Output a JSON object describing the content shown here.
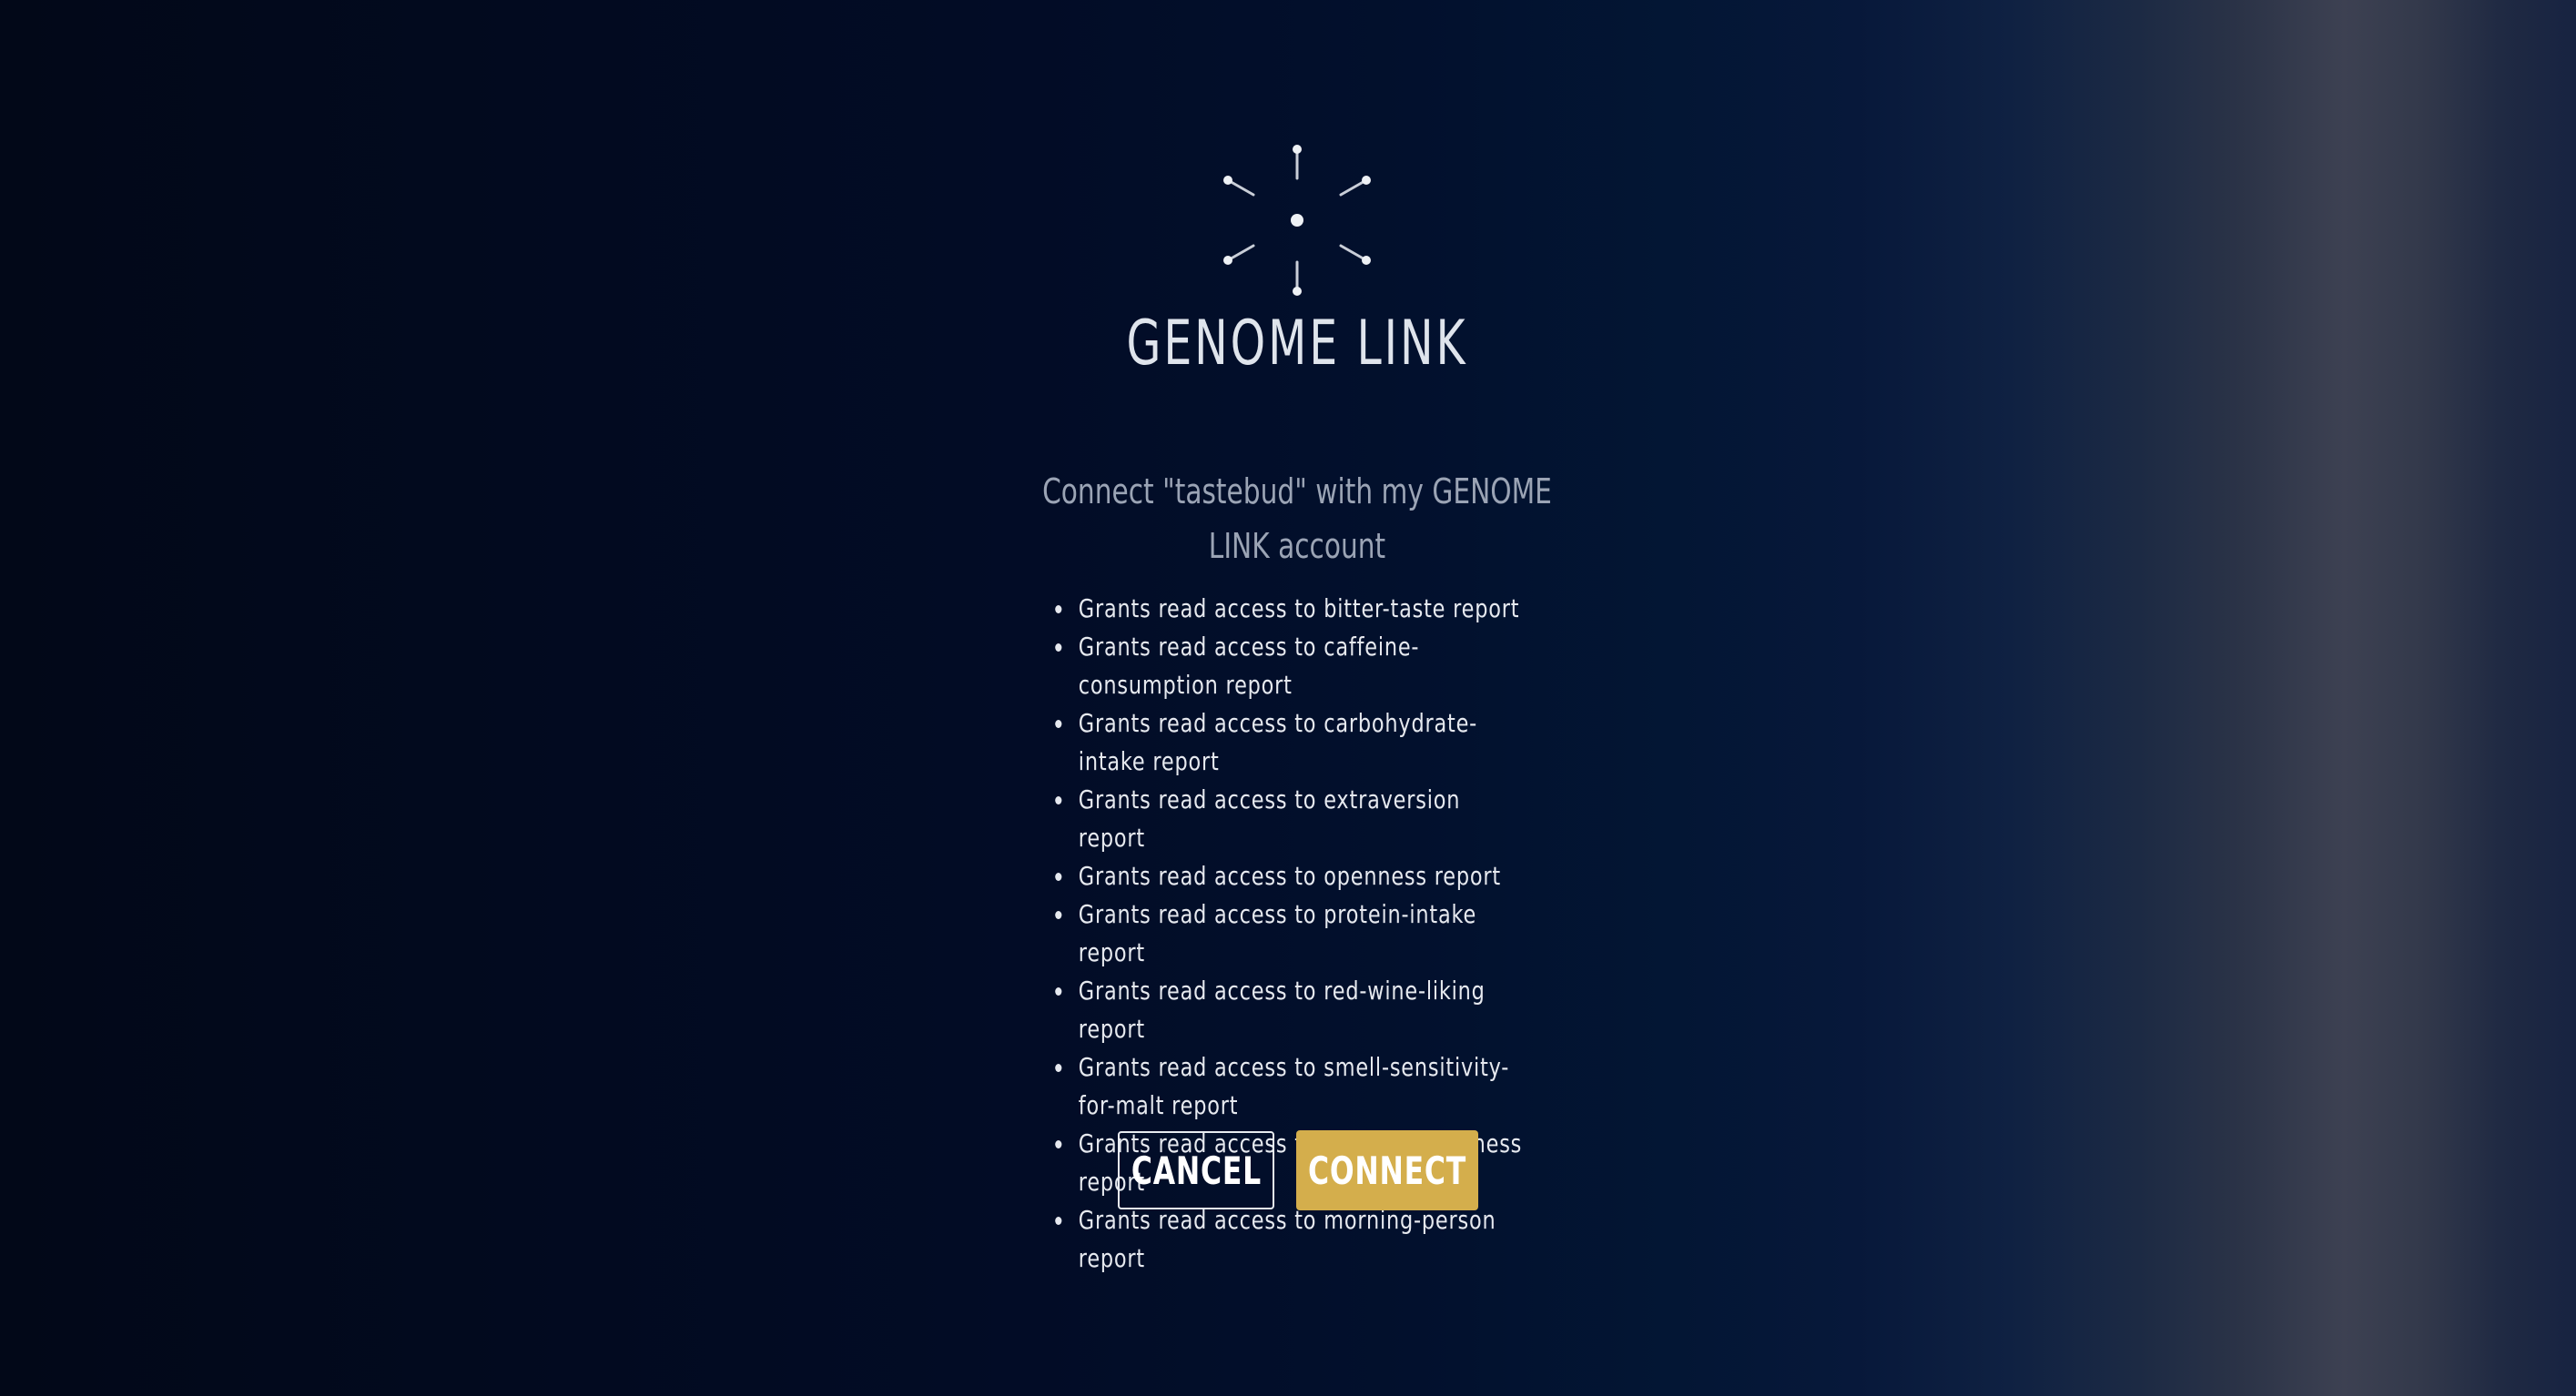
{
  "brand": {
    "logo_icon": "burst-icon",
    "name": "GENOME LINK"
  },
  "dialog": {
    "headline": "Connect \"tastebud\" with my GENOME LINK account",
    "grants": [
      "Grants read access to bitter-taste report",
      "Grants read access to caffeine-consumption report",
      "Grants read access to carbohydrate-intake report",
      "Grants read access to extraversion report",
      "Grants read access to openness report",
      "Grants read access to protein-intake report",
      "Grants read access to red-wine-liking report",
      "Grants read access to smell-sensitivity-for-malt report",
      "Grants read access to conscientiousness report",
      "Grants read access to morning-person report"
    ]
  },
  "actions": {
    "cancel_label": "CANCEL",
    "connect_label": "CONNECT"
  },
  "colors": {
    "background_dark": "#020818",
    "accent_gold": "#d4ae4c",
    "text_light": "#e6e9ef",
    "text_muted": "#9ba4b5"
  }
}
